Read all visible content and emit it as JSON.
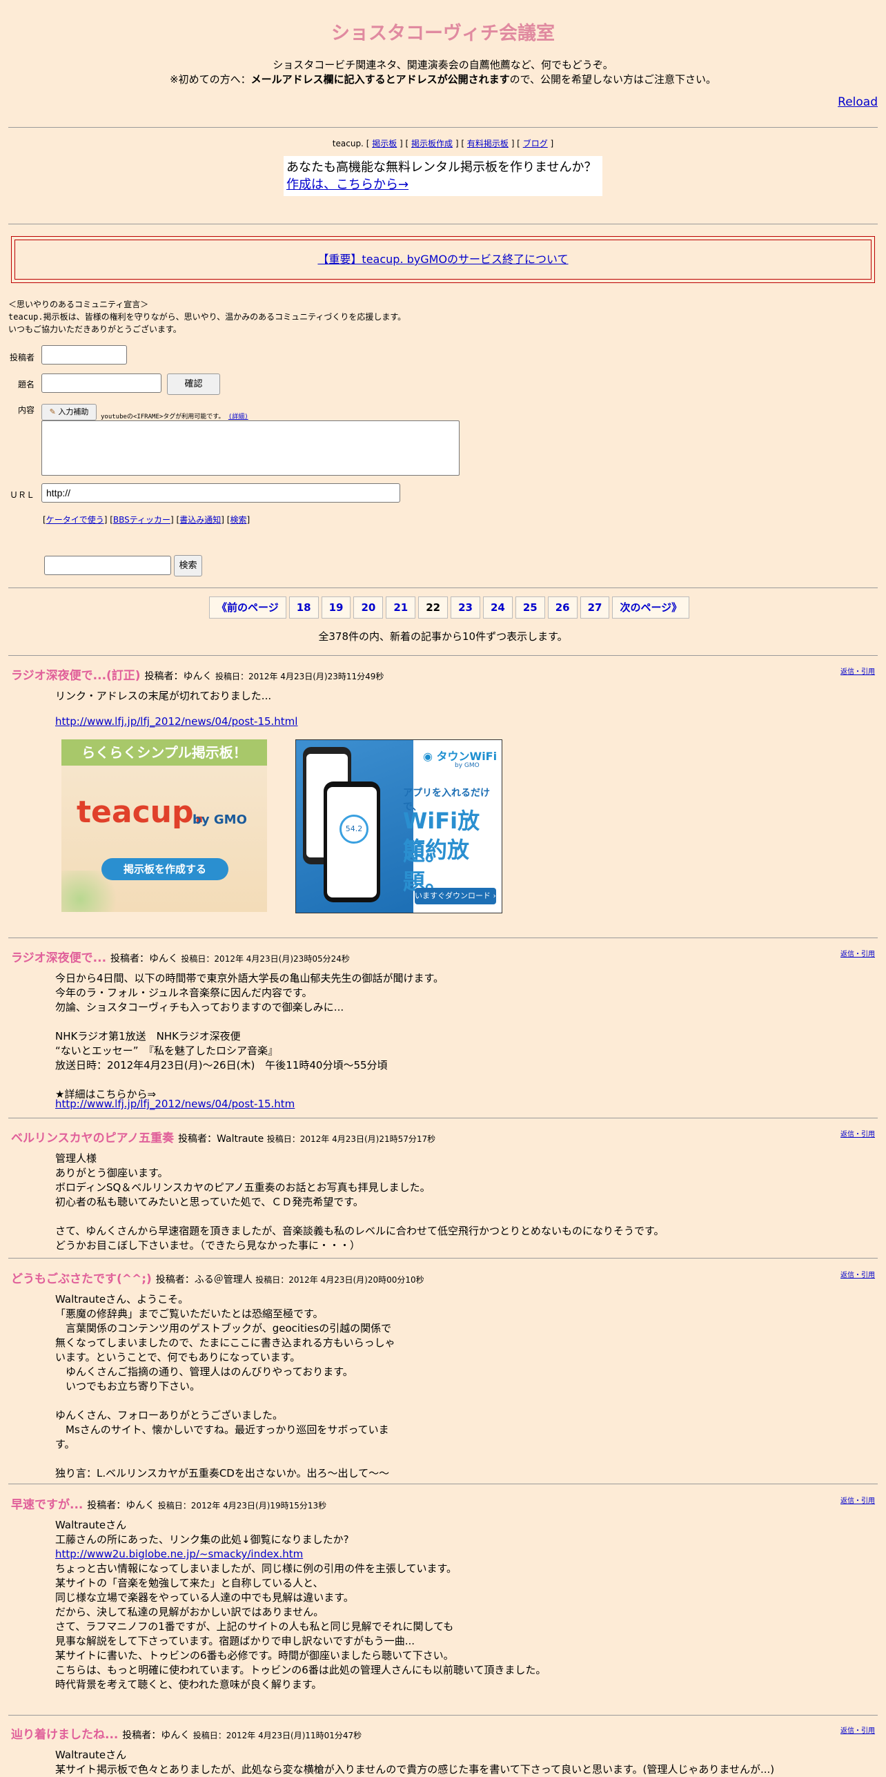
{
  "page": {
    "title": "ショスタコーヴィチ会議室",
    "intro_line1": "ショスタコービチ関連ネタ、関連演奏会の自薦他薦など、何でもどうぞ。",
    "intro_line2_prefix": "※初めての方へ：",
    "intro_line2_bold": "メールアドレス欄に記入するとアドレスが公開されます",
    "intro_line2_suffix": "ので、公開を希望しない方はご注意下さい。",
    "reload": "Reload"
  },
  "teacup_nav": {
    "prefix": "teacup. [",
    "links": [
      "掲示板",
      "掲示板作成",
      "有料掲示板",
      "ブログ"
    ],
    "rental_text": "あなたも高機能な無料レンタル掲示板を作りませんか？",
    "rental_link": "作成は、こちらから→"
  },
  "notice": "【重要】teacup. byGMOのサービス終了について",
  "declaration": [
    "＜思いやりのあるコミュニティ宣言＞",
    "teacup.掲示板は、皆様の権利を守りながら、思いやり、温かみのあるコミュニティづくりを応援します。",
    "いつもご協力いただきありがとうございます。"
  ],
  "form": {
    "name_label": "投稿者",
    "subject_label": "題名",
    "confirm_button": "確認",
    "content_label": "内容",
    "assist_button": "入力補助",
    "youtube_note": "youtubeの<IFRAME>タグが利用可能です。",
    "detail_link": "(詳細)",
    "url_label": "ＵＲＬ",
    "url_value": "http://",
    "links": [
      "ケータイで使う",
      "BBSティッカー",
      "書込み通知",
      "検索"
    ],
    "search_button": "検索"
  },
  "pager": {
    "prev": "《前のページ",
    "pages": [
      "18",
      "19",
      "20",
      "21",
      "22",
      "23",
      "24",
      "25",
      "26",
      "27"
    ],
    "current": "22",
    "next": "次のページ》",
    "count": "全378件の内、新着の記事から10件ずつ表示します。"
  },
  "reply_label": "返信・引用",
  "posts": [
    {
      "title": "ラジオ深夜便で...(訂正)",
      "author": "投稿者：ゆんく",
      "date": "投稿日：2012年 4月23日(月)23時11分49秒",
      "body": "リンク・アドレスの末尾が切れておりました...",
      "link": "http://www.lfj.jp/lfj_2012/news/04/post-15.html"
    },
    {
      "title": "ラジオ深夜便で...",
      "author": "投稿者：ゆんく",
      "date": "投稿日：2012年 4月23日(月)23時05分24秒",
      "body": "今日から4日間、以下の時間帯で東京外語大学長の亀山郁夫先生の御話が聞けます。\n今年のラ・フォル・ジュルネ音楽祭に因んだ内容です。\n勿論、ショスタコーヴィチも入っておりますので御楽しみに...\n\nNHKラジオ第1放送　NHKラジオ深夜便\n“ないとエッセー”　『私を魅了したロシア音楽』\n放送日時：2012年4月23日(月)～26日(木)　午後11時40分頃～55分頃\n\n★詳細はこちらから⇒",
      "link": "http://www.lfj.jp/lfj_2012/news/04/post-15.htm"
    },
    {
      "title": "ベルリンスカヤのピアノ五重奏",
      "author": "投稿者：Waltraute",
      "date": "投稿日：2012年 4月23日(月)21時57分17秒",
      "body": "管理人様\nありがとう御座います。\nボロディンSQ＆ベルリンスカヤのピアノ五重奏のお話とお写真も拝見しました。\n初心者の私も聴いてみたいと思っていた処で、ＣＤ発売希望です。\n\nさて、ゆんくさんから早速宿題を頂きましたが、音楽談義も私のレベルに合わせて低空飛行かつとりとめないものになりそうです。\nどうかお目こぼし下さいませ。（できたら見なかった事に・・・）"
    },
    {
      "title": "どうもごぶさたです(^^;)",
      "author": "投稿者：ふる＠管理人",
      "date": "投稿日：2012年 4月23日(月)20時00分10秒",
      "body": "Waltrauteさん、ようこそ。\n「悪魔の修辞典」までご覧いただいたとは恐縮至極です。\n　言葉関係のコンテンツ用のゲストブックが、geocitiesの引越の関係で\n無くなってしまいましたので、たまにここに書き込まれる方もいらっしゃ\nいます。ということで、何でもありになっています。\n　ゆんくさんご指摘の通り、管理人はのんびりやっております。\n　いつでもお立ち寄り下さい。\n\nゆんくさん、フォローありがとうございました。\n　Msさんのサイト、懐かしいですね。最近すっかり巡回をサボっていま\nす。\n\n独り言：L.ベルリンスカヤが五重奏CDを出さないか。出ろ～出して～～"
    },
    {
      "title": "早速ですが...",
      "author": "投稿者：ゆんく",
      "date": "投稿日：2012年 4月23日(月)19時15分13秒",
      "body_a": "Waltrauteさん\n工藤さんの所にあった、リンク集の此処↓御覧になりましたか?",
      "link": "http://www2u.biglobe.ne.jp/~smacky/index.htm",
      "body_b": "ちょっと古い情報になってしまいましたが、同じ様に例の引用の件を主張しています。\n某サイトの「音楽を勉強して来た」と自称している人と、\n同じ様な立場で楽器をやっている人達の中でも見解は違います。\nだから、決して私達の見解がおかしい訳ではありません。\nさて、ラフマニノフの1番ですが、上記のサイトの人も私と同じ見解でそれに関しても\n見事な解説をして下さっています。宿題ばかりで申し訳ないですがもう一曲...\n某サイトに書いた、トゥビンの6番も必修です。時間が御座いましたら聴いて下さい。\nこちらは、もっと明確に使われています。トゥビンの6番は此処の管理人さんにも以前聴いて頂きました。\n時代背景を考えて聴くと、使われた意味が良く解ります。"
    },
    {
      "title": "辿り着けましたね...",
      "author": "投稿者：ゆんく",
      "date": "投稿日：2012年 4月23日(月)11時01分47秒",
      "body": "Waltrauteさん\n某サイト掲示板で色々とありましたが、此処なら変な横槍が入りませんので貴方の感じた事を書いて下さって良いと思います。(管理人じゃありませんが...)"
    }
  ],
  "ads": {
    "ad1_tagline": "らくらくシンプル掲示板！",
    "ad1_logo": "teacup.",
    "ad1_logo_by": "by GMO",
    "ad1_button": "掲示板を作成する",
    "ad2_brand": "タウンWiFi",
    "ad2_brand_by": "by GMO",
    "ad2_lead": "アプリを入れるだけで、",
    "ad2_line1": "WiFi放題。",
    "ad2_line2": "節約放題。",
    "ad2_button": "いますぐダウンロード ›",
    "ad2_phone_value": "54.2"
  }
}
